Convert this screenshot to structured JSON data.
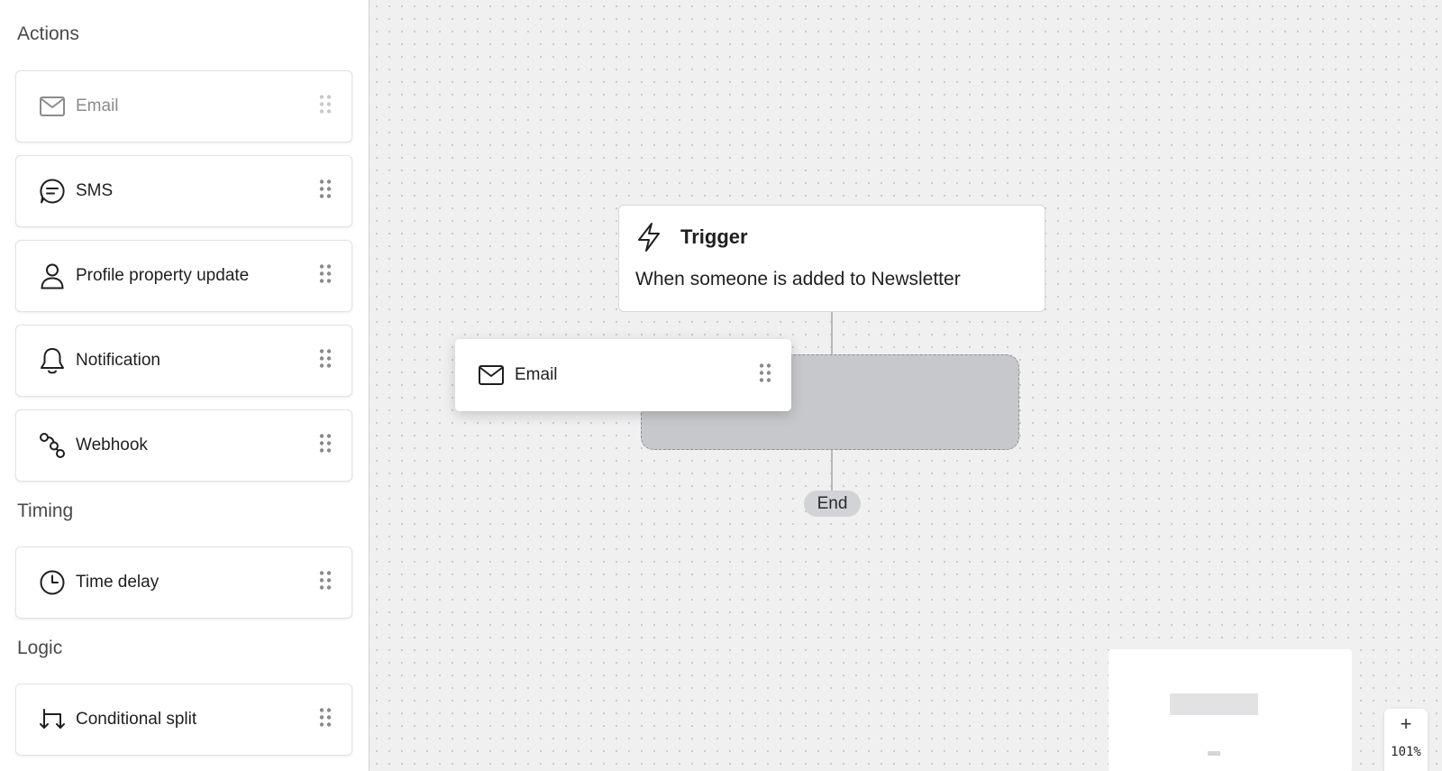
{
  "sidebar": {
    "sections": [
      {
        "heading": "Actions",
        "items": [
          {
            "label": "Email",
            "icon": "mail-icon"
          },
          {
            "label": "SMS",
            "icon": "sms-icon"
          },
          {
            "label": "Profile property update",
            "icon": "person-icon"
          },
          {
            "label": "Notification",
            "icon": "bell-icon"
          },
          {
            "label": "Webhook",
            "icon": "webhook-icon"
          }
        ]
      },
      {
        "heading": "Timing",
        "items": [
          {
            "label": "Time delay",
            "icon": "clock-icon"
          }
        ]
      },
      {
        "heading": "Logic",
        "items": [
          {
            "label": "Conditional split",
            "icon": "split-icon"
          }
        ]
      }
    ]
  },
  "canvas": {
    "trigger": {
      "title": "Trigger",
      "description": "When someone is added to Newsletter",
      "icon": "lightning-icon"
    },
    "dragging_card": {
      "label": "Email",
      "icon": "mail-icon"
    },
    "end_label": "End",
    "zoom": {
      "in_label": "+",
      "level": "101%"
    }
  }
}
